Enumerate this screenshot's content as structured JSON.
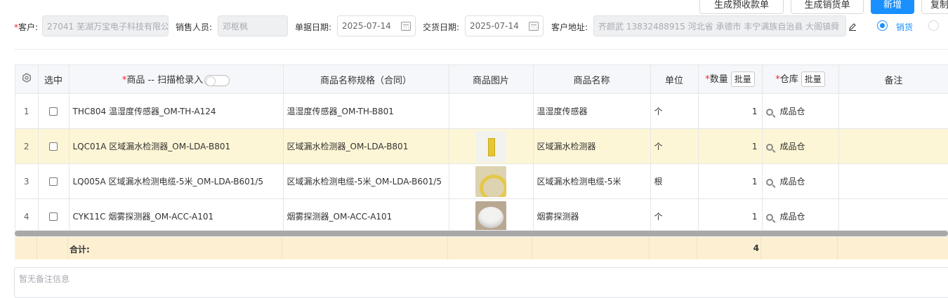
{
  "toolbar": {
    "btn_prepayment": "生成预收款单",
    "btn_sales_delivery": "生成销货单",
    "btn_new": "新增",
    "btn_copy": "复制"
  },
  "form": {
    "customer_label": "客户:",
    "customer_value": "27041 芜湖万宝电子科技有限公",
    "salesperson_label": "销售人员:",
    "salesperson_value": "邓枢枫",
    "doc_date_label": "单据日期:",
    "doc_date_value": "2025-07-14",
    "delivery_date_label": "交货日期:",
    "delivery_date_value": "2025-07-14",
    "address_label": "客户地址:",
    "address_value": "齐颜武 13832488915 河北省 承德市 丰宁满族自治县 大阁镇舜",
    "radio_sales": "销货",
    "radio_sales_selected": true
  },
  "table": {
    "headers": {
      "selected": "选中",
      "product": "商品 -- 扫描枪录入",
      "spec": "商品名称规格（合同）",
      "image": "商品图片",
      "name": "商品名称",
      "unit": "单位",
      "qty": "数量",
      "batch": "批量",
      "warehouse": "仓库",
      "remark": "备注"
    },
    "rows": [
      {
        "idx": "1",
        "product": "THC804 温湿度传感器_OM-TH-A124",
        "spec": "温湿度传感器_OM-TH-B801",
        "name": "温湿度传感器",
        "unit": "个",
        "qty": "1",
        "warehouse": "成品仓",
        "has_image": false
      },
      {
        "idx": "2",
        "product": "LQC01A 区域漏水检测器_OM-LDA-B801",
        "spec": "区域漏水检测器_OM-LDA-B801",
        "name": "区域漏水检测器",
        "unit": "个",
        "qty": "1",
        "warehouse": "成品仓",
        "has_image": true
      },
      {
        "idx": "3",
        "product": "LQ005A 区域漏水检测电缆-5米_OM-LDA-B601/5",
        "spec": "区域漏水检测电缆-5米_OM-LDA-B601/5",
        "name": "区域漏水检测电缆-5米",
        "unit": "根",
        "qty": "1",
        "warehouse": "成品仓",
        "has_image": true
      },
      {
        "idx": "4",
        "product": "CYK11C 烟雾探测器_OM-ACC-A101",
        "spec": "烟雾探测器_OM-ACC-A101",
        "name": "烟雾探测器",
        "unit": "个",
        "qty": "1",
        "warehouse": "成品仓",
        "has_image": true
      }
    ],
    "total_label": "合计:",
    "total_qty": "4"
  },
  "remark_placeholder": "暂无备注信息",
  "colors": {
    "primary": "#1890ff",
    "highlight_row": "#fdf6d6",
    "total_row": "#fdf0d2",
    "required": "#f5222d"
  }
}
